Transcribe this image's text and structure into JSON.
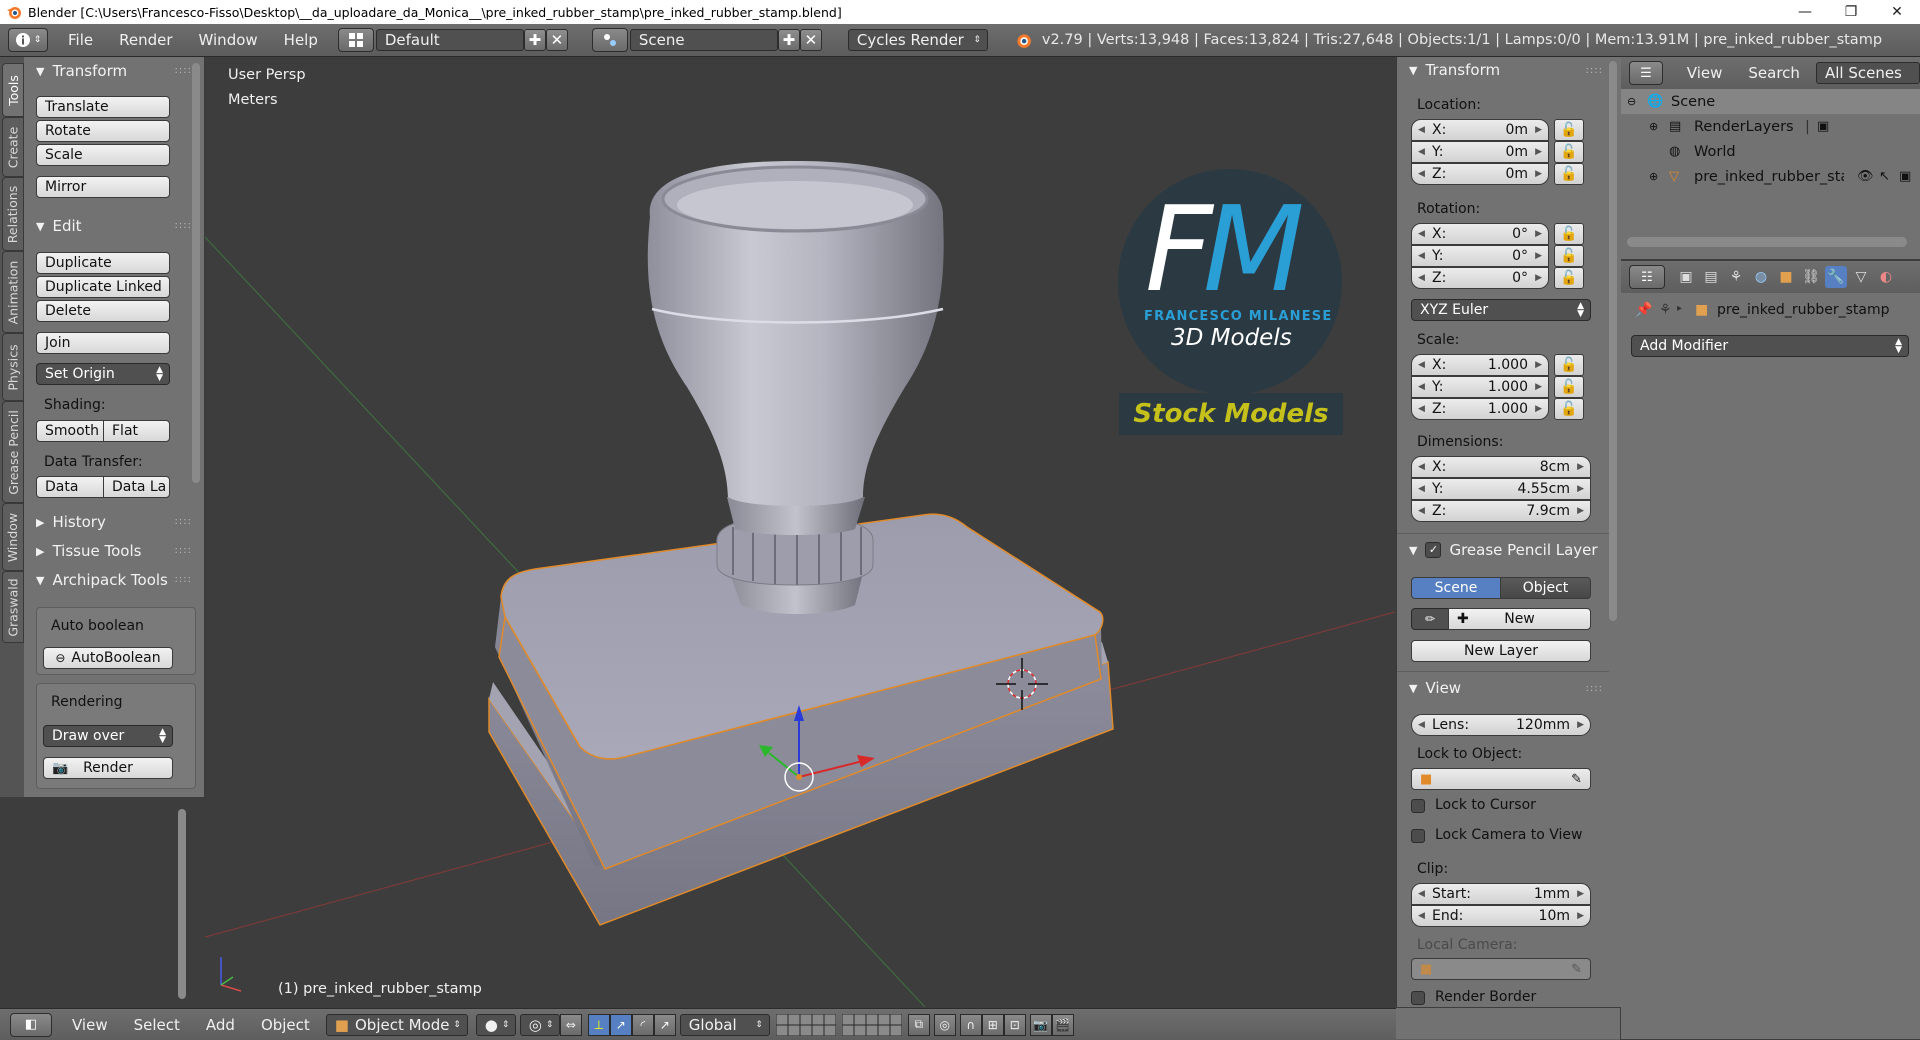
{
  "window": {
    "title": "Blender [C:\\Users\\Francesco-Fisso\\Desktop\\__da_uploadare_da_Monica__\\pre_inked_rubber_stamp\\pre_inked_rubber_stamp.blend]",
    "minimize": "—",
    "maximize": "❐",
    "close": "✕"
  },
  "info_header": {
    "menus": [
      "File",
      "Render",
      "Window",
      "Help"
    ],
    "layout": "Default",
    "scene": "Scene",
    "engine": "Cycles Render",
    "stats": "v2.79 | Verts:13,948 | Faces:13,824 | Tris:27,648 | Objects:1/1 | Lamps:0/0 | Mem:13.91M | pre_inked_rubber_stamp"
  },
  "tabs": [
    "Tools",
    "Create",
    "Relations",
    "Animation",
    "Physics",
    "Grease Pencil",
    "Window",
    "Graswald"
  ],
  "toolshelf": {
    "transform": {
      "title": "Transform",
      "buttons": [
        "Translate",
        "Rotate",
        "Scale",
        "Mirror"
      ]
    },
    "edit": {
      "title": "Edit",
      "buttons": [
        "Duplicate",
        "Duplicate Linked",
        "Delete",
        "Join"
      ],
      "set_origin": "Set Origin",
      "shading_label": "Shading:",
      "smooth": "Smooth",
      "flat": "Flat",
      "data_transfer_label": "Data Transfer:",
      "data": "Data",
      "data_layers": "Data La"
    },
    "history": "History",
    "tissue": "Tissue Tools",
    "archipack": {
      "title": "Archipack Tools",
      "auto_boolean_label": "Auto boolean",
      "auto_boolean_btn": "AutoBoolean",
      "rendering_label": "Rendering",
      "draw_over": "Draw over",
      "render": "Render"
    }
  },
  "viewport": {
    "view_name": "User Persp",
    "units": "Meters",
    "object_label": "(1) pre_inked_rubber_stamp",
    "watermark": {
      "letters": "FM",
      "brand": "FRANCESCO MILANESE",
      "subtitle": "3D Models",
      "banner": "Stock Models",
      "colors": {
        "circle": "#2b3a42",
        "f": "#ffffff",
        "m": "#2a9fd6",
        "banner_text": "#c6c11a"
      }
    }
  },
  "bottom_bar": {
    "menus": [
      "View",
      "Select",
      "Add",
      "Object"
    ],
    "mode": "Object Mode",
    "orientation": "Global"
  },
  "npanel": {
    "transform_title": "Transform",
    "location_label": "Location:",
    "location": [
      {
        "axis": "X:",
        "value": "0m"
      },
      {
        "axis": "Y:",
        "value": "0m"
      },
      {
        "axis": "Z:",
        "value": "0m"
      }
    ],
    "rotation_label": "Rotation:",
    "rotation": [
      {
        "axis": "X:",
        "value": "0°"
      },
      {
        "axis": "Y:",
        "value": "0°"
      },
      {
        "axis": "Z:",
        "value": "0°"
      }
    ],
    "rotation_mode": "XYZ Euler",
    "scale_label": "Scale:",
    "scale": [
      {
        "axis": "X:",
        "value": "1.000"
      },
      {
        "axis": "Y:",
        "value": "1.000"
      },
      {
        "axis": "Z:",
        "value": "1.000"
      }
    ],
    "dimensions_label": "Dimensions:",
    "dimensions": [
      {
        "axis": "X:",
        "value": "8cm"
      },
      {
        "axis": "Y:",
        "value": "4.55cm"
      },
      {
        "axis": "Z:",
        "value": "7.9cm"
      }
    ],
    "grease_title": "Grease Pencil Layer",
    "scene_btn": "Scene",
    "object_btn": "Object",
    "new_btn": "New",
    "new_layer_btn": "New Layer",
    "view_title": "View",
    "lens_label": "Lens:",
    "lens_value": "120mm",
    "lock_to_object": "Lock to Object:",
    "lock_to_cursor": "Lock to Cursor",
    "lock_camera": "Lock Camera to View",
    "clip_label": "Clip:",
    "clip_start_label": "Start:",
    "clip_start": "1mm",
    "clip_end_label": "End:",
    "clip_end": "10m",
    "local_camera": "Local Camera:",
    "render_border": "Render Border"
  },
  "outliner": {
    "view": "View",
    "search": "Search",
    "filter": "All Scenes",
    "items": [
      "Scene",
      "RenderLayers",
      "World",
      "pre_inked_rubber_stan"
    ]
  },
  "properties": {
    "object_name": "pre_inked_rubber_stamp",
    "add_modifier": "Add Modifier"
  }
}
